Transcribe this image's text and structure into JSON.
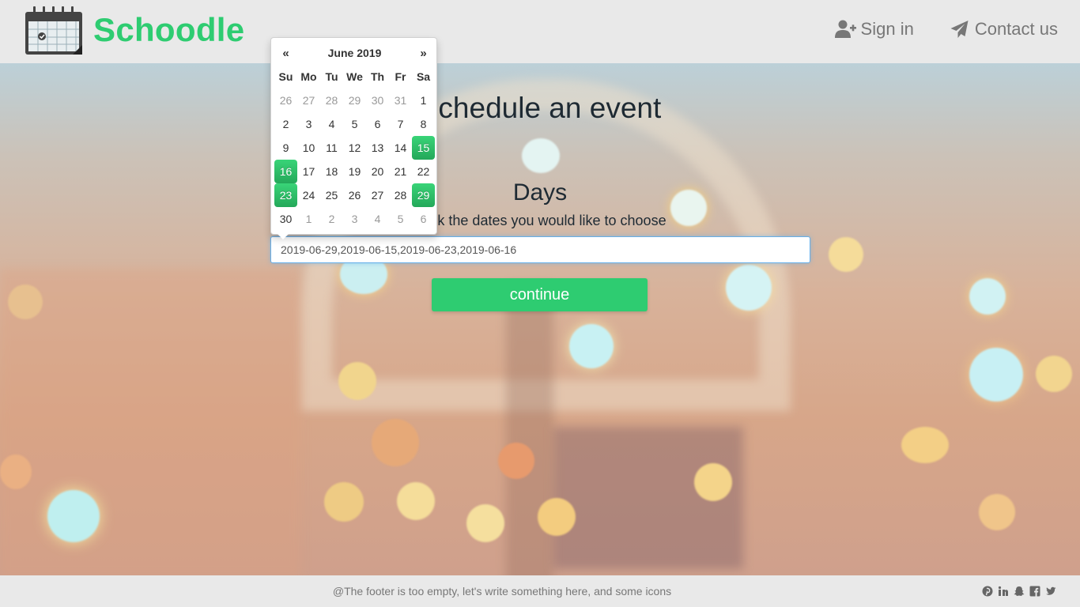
{
  "header": {
    "brand": "Schoodle",
    "nav": [
      {
        "label": "Sign in",
        "icon": "user-plus-icon"
      },
      {
        "label": "Contact us",
        "icon": "paper-plane-icon"
      }
    ]
  },
  "main": {
    "title": "Schedule an event",
    "section_title": "Days",
    "hint": "Click the dates you would like to choose",
    "dates_value": "2019-06-29,2019-06-15,2019-06-23,2019-06-16",
    "continue_label": "continue"
  },
  "datepicker": {
    "prev": "«",
    "next": "»",
    "month_label": "June 2019",
    "weekdays": [
      "Su",
      "Mo",
      "Tu",
      "We",
      "Th",
      "Fr",
      "Sa"
    ],
    "weeks": [
      [
        {
          "d": "26",
          "old": true
        },
        {
          "d": "27",
          "old": true
        },
        {
          "d": "28",
          "old": true
        },
        {
          "d": "29",
          "old": true
        },
        {
          "d": "30",
          "old": true
        },
        {
          "d": "31",
          "old": true
        },
        {
          "d": "1"
        }
      ],
      [
        {
          "d": "2"
        },
        {
          "d": "3"
        },
        {
          "d": "4"
        },
        {
          "d": "5"
        },
        {
          "d": "6"
        },
        {
          "d": "7"
        },
        {
          "d": "8"
        }
      ],
      [
        {
          "d": "9"
        },
        {
          "d": "10"
        },
        {
          "d": "11"
        },
        {
          "d": "12"
        },
        {
          "d": "13"
        },
        {
          "d": "14"
        },
        {
          "d": "15",
          "active": true
        }
      ],
      [
        {
          "d": "16",
          "active": true
        },
        {
          "d": "17"
        },
        {
          "d": "18"
        },
        {
          "d": "19"
        },
        {
          "d": "20"
        },
        {
          "d": "21"
        },
        {
          "d": "22"
        }
      ],
      [
        {
          "d": "23",
          "active": true
        },
        {
          "d": "24"
        },
        {
          "d": "25"
        },
        {
          "d": "26"
        },
        {
          "d": "27"
        },
        {
          "d": "28"
        },
        {
          "d": "29",
          "active": true
        }
      ],
      [
        {
          "d": "30"
        },
        {
          "d": "1",
          "old": true
        },
        {
          "d": "2",
          "old": true
        },
        {
          "d": "3",
          "old": true
        },
        {
          "d": "4",
          "old": true
        },
        {
          "d": "5",
          "old": true
        },
        {
          "d": "6",
          "old": true
        }
      ]
    ]
  },
  "footer": {
    "text": "@The footer is too empty, let's write something here, and some icons",
    "social_icons": [
      "pinterest-icon",
      "linkedin-icon",
      "snapchat-icon",
      "facebook-icon",
      "twitter-icon"
    ]
  },
  "colors": {
    "accent": "#2ecc71",
    "text_dark": "#1e2a33",
    "muted": "#777777"
  }
}
